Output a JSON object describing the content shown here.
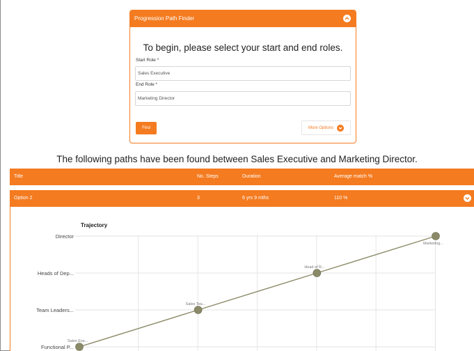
{
  "finder": {
    "title": "Progression Path Finder",
    "intro": "To begin, please select your start and end roles.",
    "start_label": "Start Role *",
    "start_value": "Sales Executive",
    "end_label": "End Role *",
    "end_value": "Marketing Director",
    "find_label": "Find",
    "more_label": "More Options"
  },
  "results": {
    "heading": "The following paths have been found between Sales Executive and Marketing Director.",
    "columns": [
      "Title",
      "No. Steps",
      "Duration",
      "Average match %"
    ],
    "option": {
      "title": "Option 2",
      "steps": "3",
      "duration": "6 yrs 9 mths",
      "match": "110 %"
    }
  },
  "chart_data": {
    "type": "line",
    "title": "Trajectory",
    "y_categories": [
      "Functional P...",
      "Team Leaders...",
      "Heads of Dep...",
      "Director"
    ],
    "points": [
      {
        "step": 0,
        "level": 0,
        "label": "Sales Exe..."
      },
      {
        "step": 2.25,
        "level": 1,
        "label": "Sales Tea..."
      },
      {
        "step": 4.5,
        "level": 2,
        "label": "Head of R..."
      },
      {
        "step": 6.75,
        "level": 3,
        "label": "Marketing..."
      }
    ],
    "xlim": [
      0,
      6.75
    ],
    "grid": true,
    "line_color": "#8b8a68"
  }
}
